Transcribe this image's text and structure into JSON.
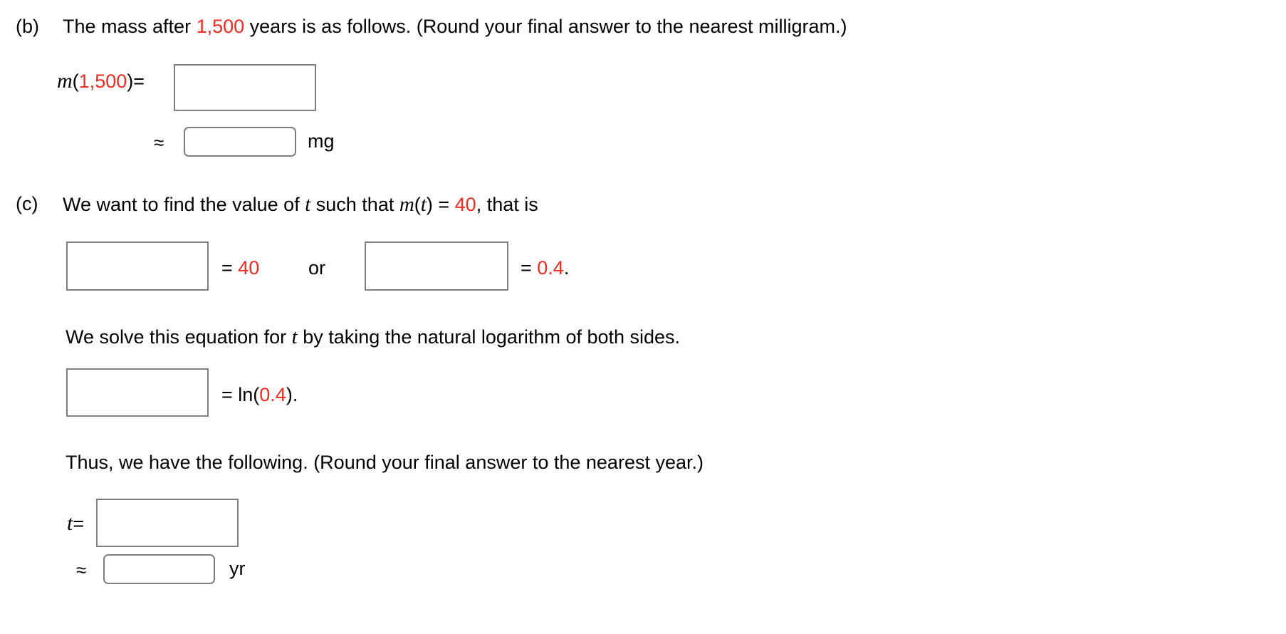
{
  "problem": {
    "parts": [
      {
        "tag": "(b)",
        "prompt_pre": "The mass after ",
        "prompt_value": "1,500",
        "prompt_post": " years is as follows. (Round your final answer to the nearest milligram.)",
        "equation_label_fn": "m",
        "equation_label_open": "(",
        "equation_label_value": "1,500",
        "equation_label_close": ")",
        "equation_label_eq": "=",
        "approx_symbol": "≈",
        "unit": "mg"
      },
      {
        "tag": "(c)",
        "prompt_pre": "We want to find the value of ",
        "prompt_var": "t",
        "prompt_mid": " such that ",
        "prompt_fn": "m",
        "prompt_fn_open": "(",
        "prompt_fn_var": "t",
        "prompt_fn_close": ")",
        "prompt_eq": " = ",
        "prompt_value": "40",
        "prompt_post": ", that is",
        "row1_eq_left": "= ",
        "row1_value_left": "40",
        "row1_conjunction": "or",
        "row1_eq_right": "= ",
        "row1_value_right": "0.4",
        "row1_period_right": ".",
        "solve_text_pre": "We solve this equation for ",
        "solve_text_var": "t",
        "solve_text_post": " by taking the natural logarithm of both sides.",
        "row2_eq": "= ln(",
        "row2_value": "0.4",
        "row2_close": ").",
        "thus_text": "Thus, we have the following. (Round your final answer to the nearest year.)",
        "t_label": "t",
        "t_eq": "=",
        "approx_symbol": "≈",
        "unit": "yr"
      }
    ],
    "inputs": {
      "b_exact": "",
      "b_approx": "",
      "c_left": "",
      "c_right": "",
      "c_ln": "",
      "c_t_exact": "",
      "c_t_approx": ""
    },
    "colors": {
      "accent_red": "#ef2b20",
      "box_border": "#808080",
      "text": "#000000",
      "background": "#ffffff"
    }
  }
}
